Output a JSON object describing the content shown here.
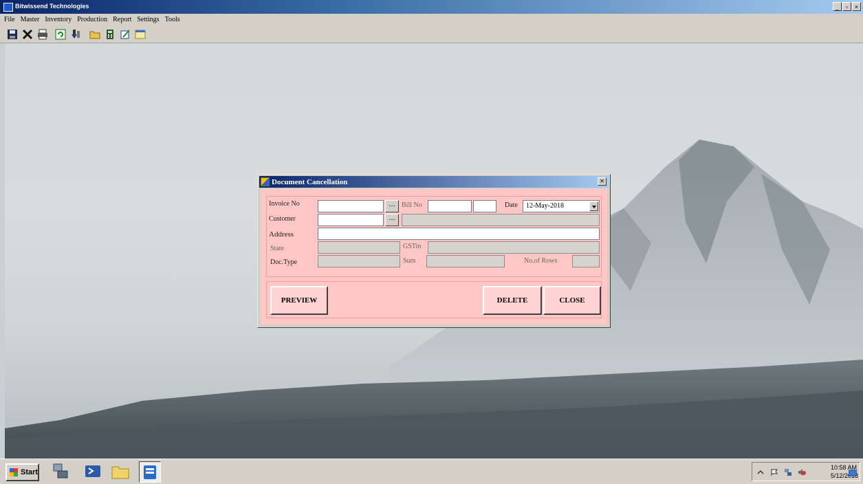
{
  "app": {
    "title": "Bitwissend Technologies",
    "window_buttons": {
      "minimize": "_",
      "maximize": "▫",
      "close": "×"
    }
  },
  "menu": [
    "File",
    "Master",
    "Inventory",
    "Production",
    "Report",
    "Settings",
    "Tools"
  ],
  "toolbar": {
    "icons": [
      "save-icon",
      "delete-icon",
      "print-icon",
      "refresh-icon",
      "import-icon",
      "folder-icon",
      "calculator-icon",
      "notes-icon",
      "window-icon"
    ]
  },
  "dialog": {
    "title": "Document Cancellation",
    "close_glyph": "×",
    "labels": {
      "invoice_no": "Invoice No",
      "bill_no": "Bill No",
      "date": "Date",
      "customer": "Customer",
      "address": "Address",
      "state": "State",
      "gstin": "GSTin",
      "doc_type": "Doc.Type",
      "sum": "Sum",
      "no_of_rows": "No.of Rows"
    },
    "ellipsis": "...",
    "values": {
      "invoice_no": "",
      "bill_no": "",
      "bill_no_suffix": "",
      "date": "12-May-2018",
      "customer": "",
      "customer_name": "",
      "address": "",
      "state": "",
      "gstin": "",
      "doc_type": "",
      "sum": "",
      "no_of_rows": ""
    },
    "buttons": {
      "preview": "PREVIEW",
      "delete": "DELETE",
      "close": "CLOSE"
    },
    "colors": {
      "body": "#ffc6c6",
      "button": "#ffd3d3"
    }
  },
  "taskbar": {
    "start_label": "Start",
    "clock_time": "10:58 AM",
    "clock_date": "5/12/2018"
  }
}
